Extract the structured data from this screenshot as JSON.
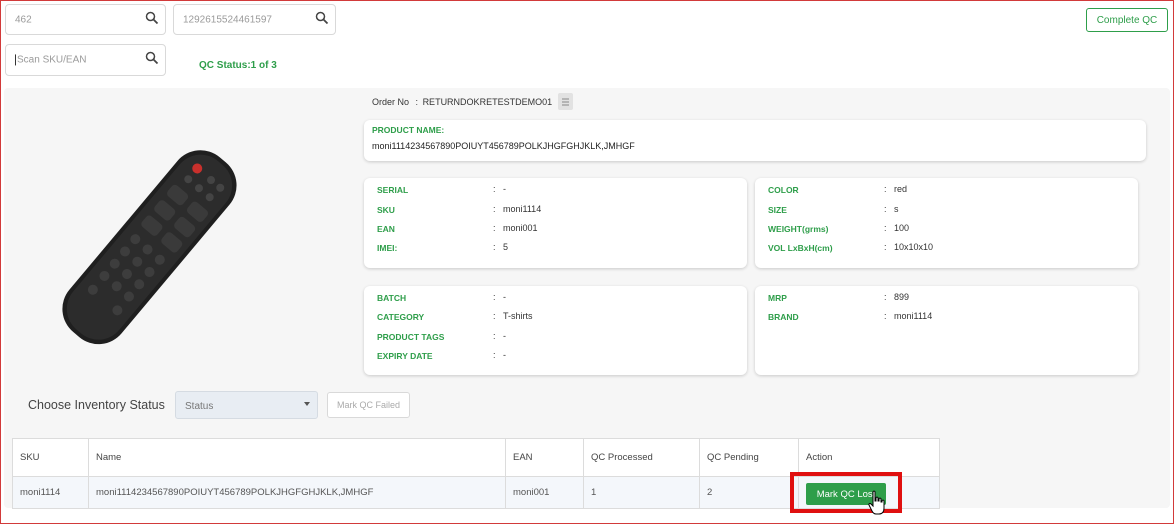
{
  "filters": {
    "field1_value": "462",
    "field2_value": "1292615524461597",
    "scan_placeholder": "Scan SKU/EAN",
    "search_icon": "search-icon"
  },
  "header": {
    "complete_qc_label": "Complete QC",
    "qc_status": "QC Status:1 of 3"
  },
  "order": {
    "label": "Order No",
    "separator": ":",
    "value": "RETURNDOKRETESTDEMO01",
    "icon": "document-icon"
  },
  "product_name": {
    "label": "PRODUCT NAME:",
    "value": "moni1114234567890POIUYT456789POLKJHGFGHJKLK,JMHGF"
  },
  "details_left": {
    "serial_label": "SERIAL",
    "serial_value": "-",
    "sku_label": "SKU",
    "sku_value": "moni1114",
    "ean_label": "EAN",
    "ean_value": "moni001",
    "imei_label": "IMEI:",
    "imei_value": "5"
  },
  "details_right": {
    "color_label": "COLOR",
    "color_value": "red",
    "size_label": "SIZE",
    "size_value": "s",
    "weight_label": "WEIGHT(grms)",
    "weight_value": "100",
    "vol_label": "VOL LxBxH(cm)",
    "vol_value": "10x10x10"
  },
  "details_left2": {
    "batch_label": "BATCH",
    "batch_value": "-",
    "category_label": "CATEGORY",
    "category_value": "T-shirts",
    "tags_label": "PRODUCT TAGS",
    "tags_value": "-",
    "expiry_label": "EXPIRY DATE",
    "expiry_value": "-"
  },
  "details_right2": {
    "mrp_label": "MRP",
    "mrp_value": "899",
    "brand_label": "BRAND",
    "brand_value": "moni1114"
  },
  "colon": ":",
  "inventory": {
    "choose_label": "Choose Inventory Status",
    "status_placeholder": "Status",
    "mark_failed_label": "Mark QC Failed"
  },
  "table": {
    "headers": [
      "SKU",
      "Name",
      "EAN",
      "QC Processed",
      "QC Pending",
      "Action"
    ],
    "row": {
      "sku": "moni1114",
      "name": "moni1114234567890POIUYT456789POLKJHGFGHJKLK,JMHGF",
      "ean": "moni001",
      "processed": "1",
      "pending": "2",
      "action_label": "Mark QC Lost"
    }
  },
  "colors": {
    "accent_green": "#2e9e4a",
    "highlight_red": "#e01010"
  }
}
